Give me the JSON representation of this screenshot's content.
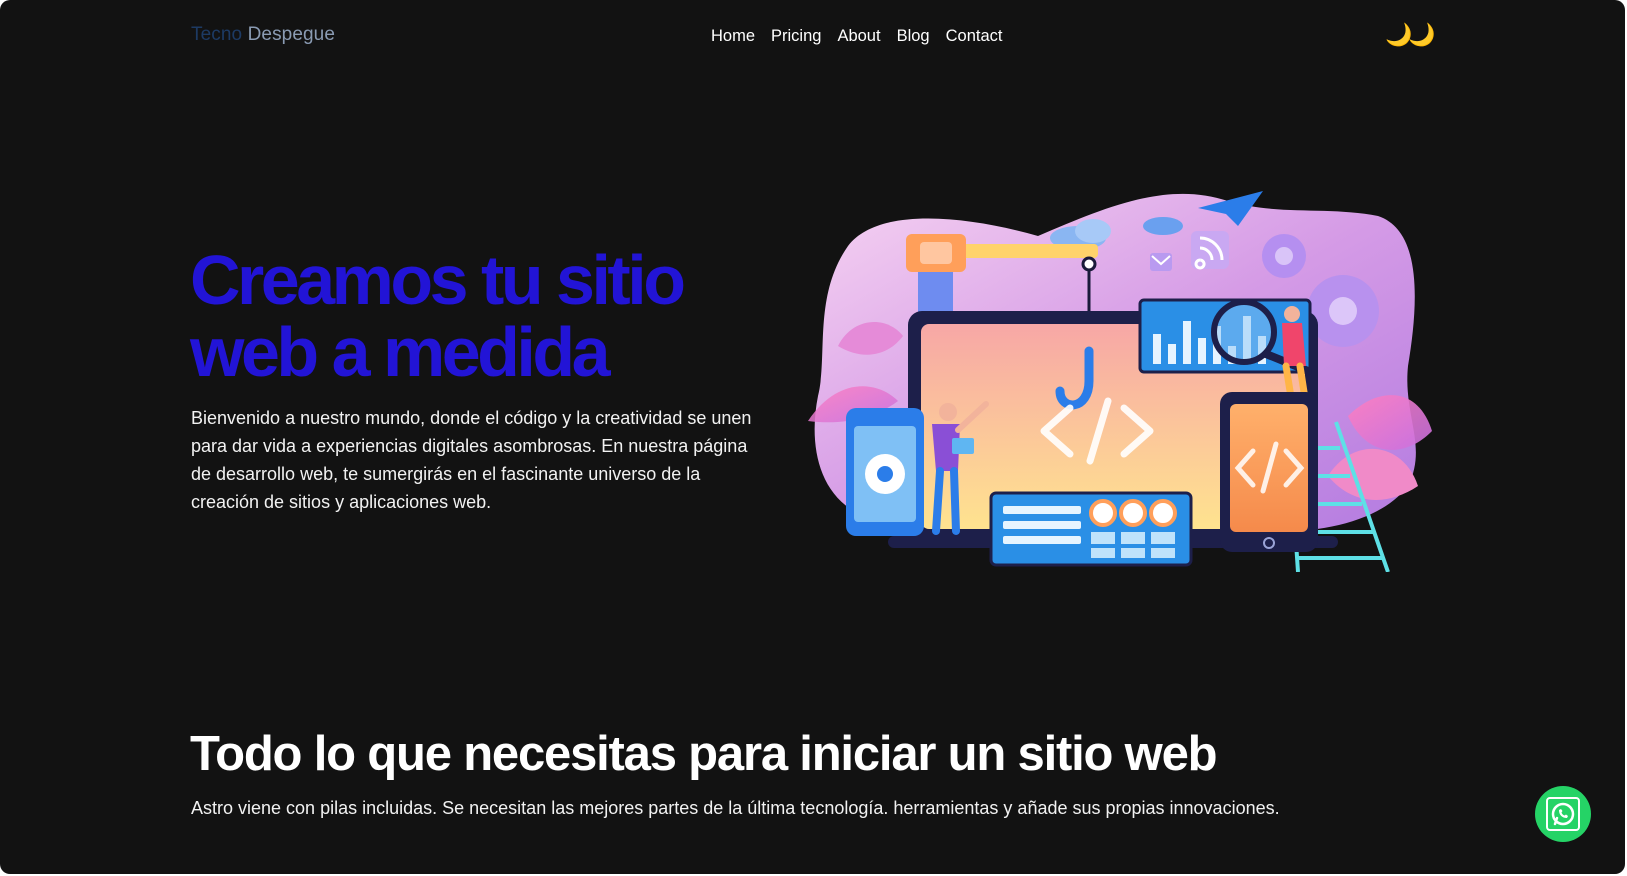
{
  "header": {
    "logo_brand": "Tecno",
    "logo_rest": " Despegue",
    "nav": [
      "Home",
      "Pricing",
      "About",
      "Blog",
      "Contact"
    ],
    "theme_icon": "moon-icon"
  },
  "hero": {
    "title": "Creamos tu sitio web a medida",
    "text": "Bienvenido a nuestro mundo, donde el código y la creatividad se unen para dar vida a experiencias digitales asombrosas. En nuestra página de desarrollo web, te sumergirás en el fascinante universo de la creación de sitios y aplicaciones web.",
    "illustration": "web-development-illustration"
  },
  "features": {
    "title": "Todo lo que necesitas para iniciar un sitio web",
    "text": "Astro viene con pilas incluidas. Se necesitan las mejores partes de la última tecnología. herramientas y añade sus propias innovaciones."
  },
  "whatsapp": {
    "icon": "whatsapp-icon"
  },
  "colors": {
    "background": "#121212",
    "accent": "#2214d6",
    "whatsapp": "#25d366"
  }
}
